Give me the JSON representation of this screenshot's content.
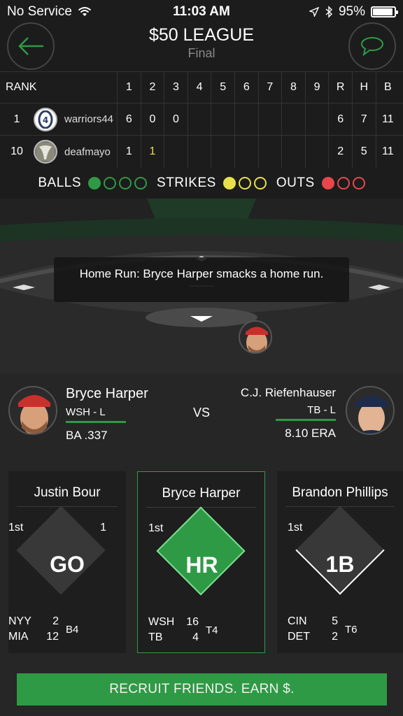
{
  "status_bar": {
    "carrier": "No Service",
    "time": "11:03 AM",
    "battery": "95%"
  },
  "header": {
    "title": "$50 LEAGUE",
    "subtitle": "Final"
  },
  "scoreboard": {
    "rank_label": "RANK",
    "innings": [
      "1",
      "2",
      "3",
      "4",
      "5",
      "6",
      "7",
      "8",
      "9"
    ],
    "totals_headers": [
      "R",
      "H",
      "B"
    ],
    "rows": [
      {
        "rank": "1",
        "team": "warriors44",
        "innings": [
          "6",
          "0",
          "0",
          "",
          "",
          "",
          "",
          "",
          ""
        ],
        "R": "6",
        "H": "7",
        "B": "11"
      },
      {
        "rank": "10",
        "team": "deafmayo",
        "innings": [
          "1",
          "1",
          "",
          "",
          "",
          "",
          "",
          "",
          ""
        ],
        "R": "2",
        "H": "5",
        "B": "11"
      }
    ]
  },
  "count": {
    "balls_label": "BALLS",
    "balls": 1,
    "strikes_label": "STRIKES",
    "strikes": 1,
    "outs_label": "OUTS",
    "outs": 1,
    "colors": {
      "balls": "#2f9a45",
      "strikes": "#e8e14a",
      "outs": "#e8474a"
    }
  },
  "field": {
    "play_text": "Home Run: Bryce Harper smacks a home run."
  },
  "matchup": {
    "batter": {
      "name": "Bryce Harper",
      "team": "WSH - L",
      "stat": "BA .337"
    },
    "vs": "VS",
    "pitcher": {
      "name": "C.J. Riefenhauser",
      "team": "TB - L",
      "stat": "8.10 ERA"
    }
  },
  "cards": [
    {
      "name": "Justin Bour",
      "inning": "1st",
      "outs": "1",
      "result": "GO",
      "teams": [
        "NYY",
        "MIA"
      ],
      "runs": [
        "2",
        "12"
      ],
      "game_inning": "B4"
    },
    {
      "name": "Bryce Harper",
      "inning": "1st",
      "outs": "",
      "result": "HR",
      "teams": [
        "WSH",
        "TB"
      ],
      "runs": [
        "16",
        "4"
      ],
      "game_inning": "T4"
    },
    {
      "name": "Brandon Phillips",
      "inning": "1st",
      "outs": "",
      "result": "1B",
      "teams": [
        "CIN",
        "DET"
      ],
      "runs": [
        "5",
        "2"
      ],
      "game_inning": "T6"
    }
  ],
  "recruit": {
    "label": "RECRUIT FRIENDS. EARN $."
  },
  "colors": {
    "accent": "#2f9a45",
    "background": "#262626",
    "panel": "#1c1c1c"
  }
}
